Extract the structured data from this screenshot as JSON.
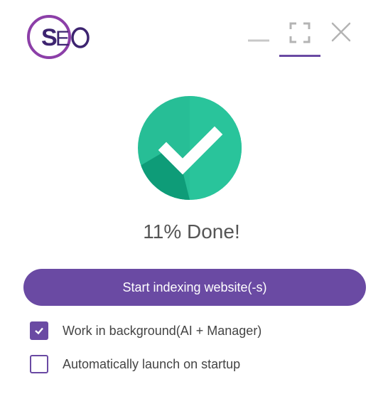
{
  "app": {
    "logo_text": "SEO",
    "brand_color": "#6a4aa3",
    "success_color": "#27be96"
  },
  "window_controls": {
    "minimize_icon": "minimize-icon",
    "maximize_icon": "maximize-icon",
    "close_icon": "close-icon"
  },
  "status": {
    "icon": "check-circle-icon",
    "progress_percent": 11,
    "text": "11% Done!"
  },
  "actions": {
    "start_label": "Start indexing website(-s)"
  },
  "options": [
    {
      "label": "Work in background(AI + Manager)",
      "checked": true
    },
    {
      "label": "Automatically launch on startup",
      "checked": false
    }
  ]
}
